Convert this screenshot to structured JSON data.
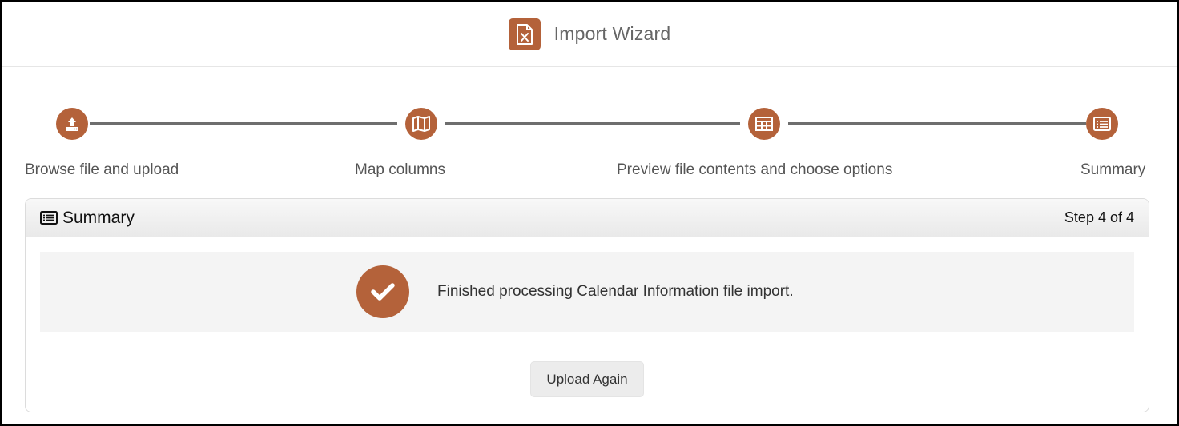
{
  "header": {
    "title": "Import Wizard",
    "logo_icon": "excel-file-icon"
  },
  "stepper": {
    "steps": [
      {
        "label": "Browse file and upload",
        "icon": "upload-icon"
      },
      {
        "label": "Map columns",
        "icon": "map-icon"
      },
      {
        "label": "Preview file contents and choose options",
        "icon": "table-icon"
      },
      {
        "label": "Summary",
        "icon": "list-icon"
      }
    ]
  },
  "panel": {
    "title": "Summary",
    "title_icon": "list-icon",
    "step_indicator": "Step 4 of 4",
    "result_message": "Finished processing Calendar Information file import.",
    "result_icon": "check-circle-icon",
    "upload_again_label": "Upload Again"
  },
  "colors": {
    "accent": "#b4623a",
    "connector": "#6e6e6e",
    "result_background": "#f4f4f4"
  }
}
